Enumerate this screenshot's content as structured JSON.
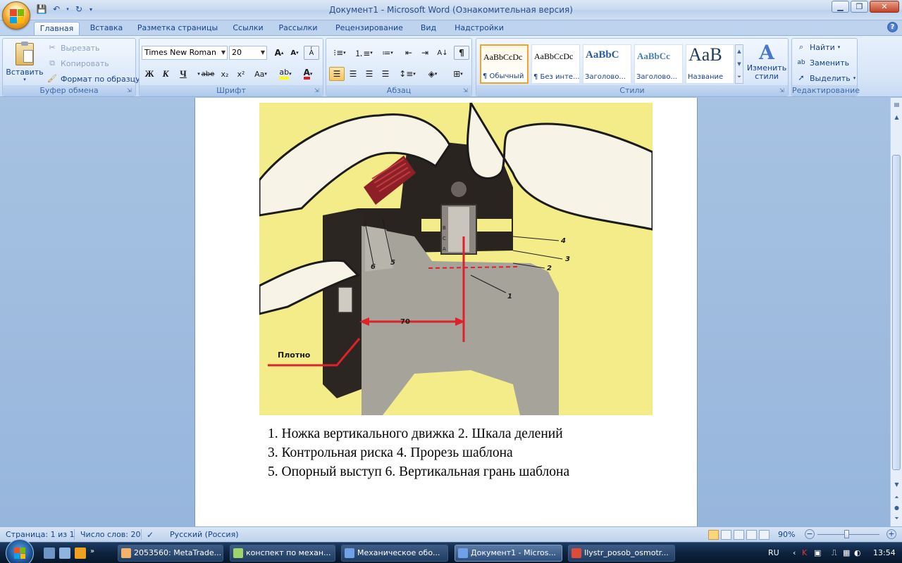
{
  "window": {
    "title": "Документ1 - Microsoft Word (Ознакомительная версия)",
    "minimize": "▁",
    "maximize": "❐",
    "close": "✕"
  },
  "tabs": [
    {
      "label": "Главная",
      "active": true
    },
    {
      "label": "Вставка"
    },
    {
      "label": "Разметка страницы"
    },
    {
      "label": "Ссылки"
    },
    {
      "label": "Рассылки"
    },
    {
      "label": "Рецензирование"
    },
    {
      "label": "Вид"
    },
    {
      "label": "Надстройки"
    }
  ],
  "help": "?",
  "clipboard": {
    "paste": "Вставить",
    "cut": "Вырезать",
    "copy": "Копировать",
    "format_painter": "Формат по образцу",
    "label": "Буфер обмена"
  },
  "font": {
    "family": "Times New Roman",
    "size": "20",
    "label": "Шрифт",
    "bold": "Ж",
    "italic": "К",
    "underline": "Ч",
    "strike": "abe",
    "subscript": "x₂",
    "superscript": "x²",
    "case": "Aa",
    "grow": "A",
    "shrink": "A"
  },
  "paragraph": {
    "label": "Абзац",
    "pilcrow": "¶"
  },
  "styles": {
    "label": "Стили",
    "items": [
      {
        "sample": "AaBbCcDc",
        "name": "¶ Обычный",
        "active": true
      },
      {
        "sample": "AaBbCcDc",
        "name": "¶ Без инте..."
      },
      {
        "sample": "AaBbC",
        "name": "Заголово..."
      },
      {
        "sample": "AaBbCc",
        "name": "Заголово..."
      },
      {
        "sample": "AaB",
        "name": "Название"
      }
    ],
    "change": "Изменить стили"
  },
  "editing": {
    "label": "Редактирование",
    "find": "Найти",
    "replace": "Заменить",
    "select": "Выделить"
  },
  "figure": {
    "label_plotno": "Плотно",
    "label_70": "70",
    "numbers": [
      "1",
      "2",
      "3",
      "4",
      "5",
      "6"
    ]
  },
  "caption": {
    "line1": "1. Ножка вертикального движка 2. Шкала делений",
    "line2": "3. Контрольная риска 4.  Прорезь шаблона",
    "line3": "5. Опорный выступ 6. Вертикальная грань шаблона"
  },
  "status": {
    "page": "Страница: 1 из 1",
    "words": "Число слов: 20",
    "language": "Русский (Россия)",
    "zoom": "90%"
  },
  "taskbar": {
    "items": [
      {
        "label": "2053560: MetaTrade...",
        "color": "#f2b26b"
      },
      {
        "label": "конспект по механ...",
        "color": "#9fd36b"
      },
      {
        "label": "Механическое обо...",
        "color": "#6fa0e8"
      },
      {
        "label": "Документ1 - Micros...",
        "color": "#6fa0e8",
        "active": true
      },
      {
        "label": "Ilystr_posob_osmotr...",
        "color": "#e04a3a"
      }
    ],
    "lang": "RU",
    "clock": "13:54"
  }
}
